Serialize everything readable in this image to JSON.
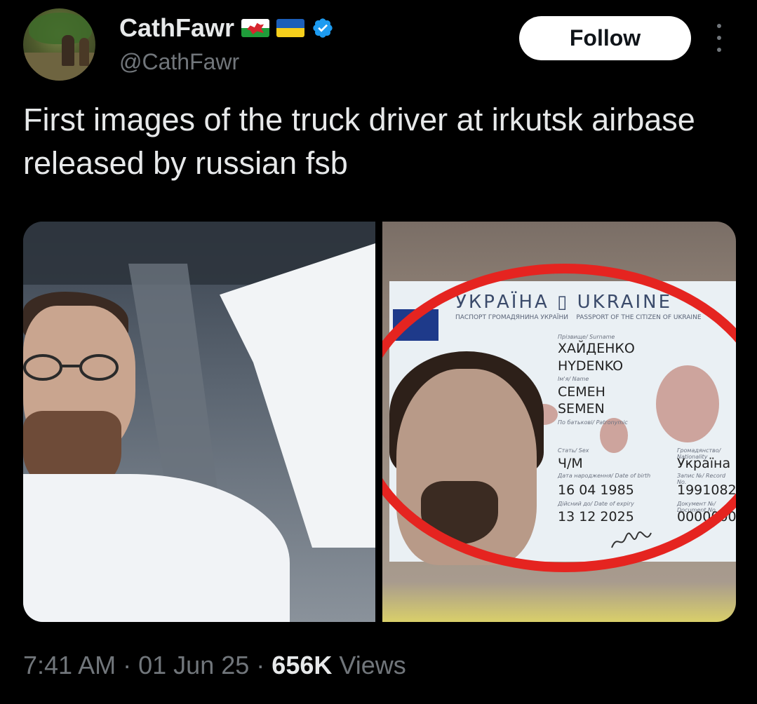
{
  "author": {
    "display_name": "CathFawr",
    "handle": "@CathFawr",
    "badges": [
      "wales-flag",
      "ukraine-flag",
      "verified-badge"
    ]
  },
  "follow_button": {
    "label": "Follow"
  },
  "more_menu": {
    "icon": "more-vertical-icon"
  },
  "tweet": {
    "text": "First images of the truck driver at irkutsk airbase released by russian fsb"
  },
  "media": {
    "left_image": "man-in-car-selfie",
    "right_image": {
      "title_ua": "УКРАЇНА",
      "title_en": "UKRAINE",
      "subtitle_left": "ПАСПОРТ ГРОМАДЯНИНА УКРАЇНИ",
      "subtitle_right": "PASSPORT OF THE CITIZEN OF UKRAINE",
      "surname_label": "Прізвище/ Surname",
      "surname_ua": "ХАЙДЕНКО",
      "surname_en": "HYDENKO",
      "name_label": "Ім'я/ Name",
      "name_ua": "СЕМЕН",
      "name_en": "SEMEN",
      "patronymic_label": "По батькові/ Patronymic",
      "sex_label": "Стать/ Sex",
      "sex": "Ч/M",
      "nationality_label": "Громадянство/ Nationality",
      "nationality": "Україна",
      "dob_label": "Дата народження/ Date of birth",
      "dob": "16 04 1985",
      "record_label": "Запис №/ Record No.",
      "record": "1991082",
      "expiry_label": "Дійсний до/ Date of expiry",
      "expiry": "13 12 2025",
      "doc_label": "Документ №/ Document No.",
      "doc": "0000000"
    }
  },
  "meta": {
    "time": "7:41 AM",
    "sep": "·",
    "date": "01 Jun 25",
    "views_count": "656K",
    "views_label": "Views"
  },
  "colors": {
    "background": "#000000",
    "text_primary": "#e7e9ea",
    "text_secondary": "#71767b",
    "verified": "#1d9bf0",
    "follow_bg": "#ffffff"
  }
}
